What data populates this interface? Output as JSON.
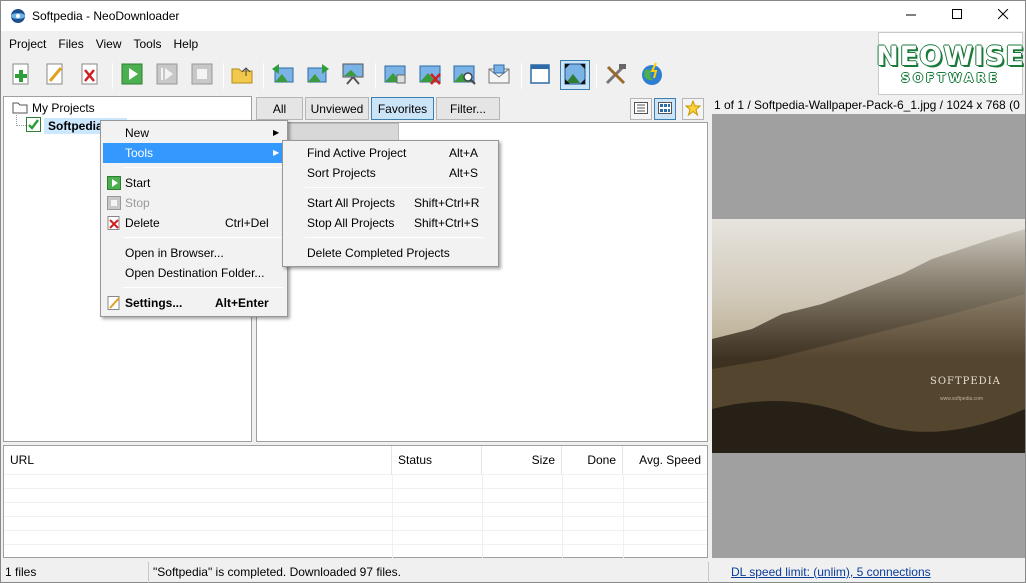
{
  "window": {
    "title": "Softpedia - NeoDownloader",
    "minimize_icon": "minimize-icon",
    "maximize_icon": "maximize-icon",
    "close_icon": "close-icon"
  },
  "menubar": [
    "Project",
    "Files",
    "View",
    "Tools",
    "Help"
  ],
  "toolbar": {
    "icons": [
      "new-project-icon",
      "edit-project-icon",
      "delete-project-icon",
      "start-icon",
      "resume-icon",
      "stop-icon",
      "open-folder-icon",
      "previous-image-icon",
      "next-image-icon",
      "slideshow-icon",
      "import-icon",
      "remove-icon",
      "search-image-icon",
      "email-icon",
      "window-icon",
      "fit-image-icon",
      "tools-icon",
      "browser-icon"
    ]
  },
  "logo": {
    "main": "NEOWISE",
    "sub": "SOFTWARE"
  },
  "tree": {
    "root": "My Projects",
    "child": "Softpedia (97"
  },
  "filters": {
    "all": "All",
    "unviewed": "Unviewed",
    "favorites": "Favorites",
    "filter": "Filter..."
  },
  "preview": {
    "info": "1 of 1 / Softpedia-Wallpaper-Pack-6_1.jpg / 1024 x 768 (0",
    "watermark": "SOFTPEDIA",
    "watermark_url": "www.softpedia.com"
  },
  "table": {
    "columns": [
      "URL",
      "Status",
      "Size",
      "Done",
      "Avg. Speed"
    ]
  },
  "statusbar": {
    "files": "1 files",
    "message": "\"Softpedia\" is completed. Downloaded 97 files.",
    "speed_link": "DL speed limit: (unlim), 5 connections"
  },
  "context_menu": {
    "new": "New",
    "tools": "Tools",
    "start": "Start",
    "stop": "Stop",
    "delete": "Delete",
    "delete_shortcut": "Ctrl+Del",
    "open_browser": "Open in Browser...",
    "open_destination": "Open Destination Folder...",
    "settings": "Settings...",
    "settings_shortcut": "Alt+Enter"
  },
  "tools_submenu": {
    "find_active": "Find Active Project",
    "find_active_shortcut": "Alt+A",
    "sort": "Sort Projects",
    "sort_shortcut": "Alt+S",
    "start_all": "Start All Projects",
    "start_all_shortcut": "Shift+Ctrl+R",
    "stop_all": "Stop All Projects",
    "stop_all_shortcut": "Shift+Ctrl+S",
    "delete_completed": "Delete Completed Projects"
  },
  "colors": {
    "highlight": "#3399ff",
    "logo_green": "#1a7a3a",
    "link": "#0b3d9a"
  }
}
